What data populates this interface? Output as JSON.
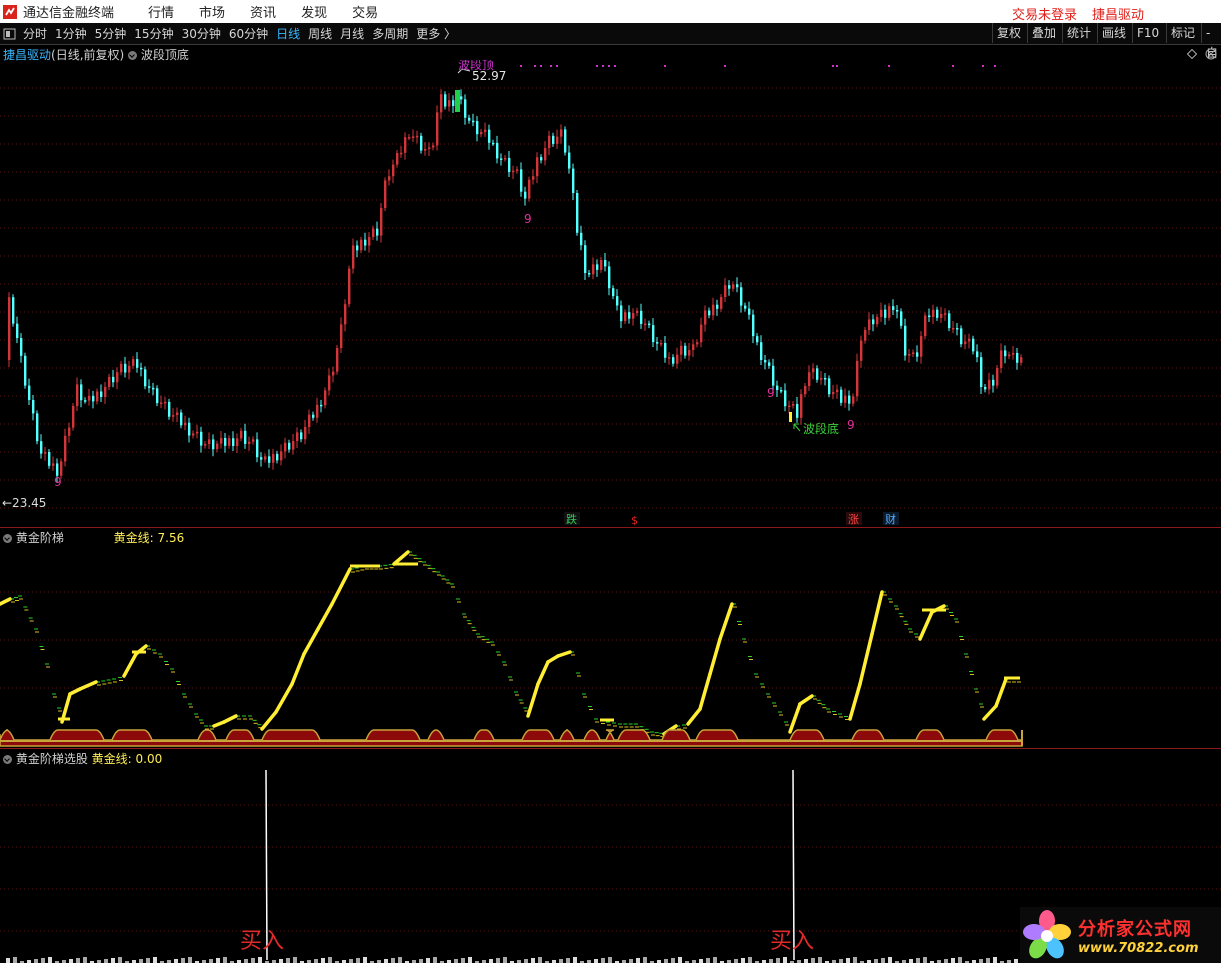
{
  "app": {
    "title": "通达信金融终端",
    "menus": [
      "行情",
      "市场",
      "资讯",
      "发现",
      "交易"
    ],
    "login_status": "交易未登录",
    "stock_name": "捷昌驱动"
  },
  "toolbar": {
    "periods": [
      "分时",
      "1分钟",
      "5分钟",
      "15分钟",
      "30分钟",
      "60分钟",
      "日线",
      "周线",
      "月线",
      "多周期",
      "更多 〉"
    ],
    "active_period": "日线",
    "right_buttons": [
      "复权",
      "叠加",
      "统计",
      "画线",
      "F10",
      "标记",
      "-自"
    ]
  },
  "main_panel": {
    "stock_name": "捷昌驱动",
    "mode": "(日线,前复权)",
    "indicator": "波段顶底",
    "high_label": "52.97",
    "low_label": "←23.45",
    "trough_label": "波段底",
    "peak_label": "波段顶",
    "nine_label": "9",
    "events": [
      {
        "text": "跌",
        "color": "#33cc55"
      },
      {
        "text": "$",
        "color": "#e02020"
      },
      {
        "text": "涨",
        "color": "#ff4444"
      },
      {
        "text": "财",
        "color": "#55aaff"
      }
    ]
  },
  "ladder_panel": {
    "name": "黄金阶梯",
    "line_label": "黄金线:",
    "line_value": "7.56"
  },
  "select_panel": {
    "name": "黄金阶梯选股",
    "line_label": "黄金线:",
    "line_value": "0.00",
    "buy_label": "买入"
  },
  "watermark": {
    "name": "分析家公式网",
    "url": "www.70822.com"
  },
  "colors": {
    "up": "#d2363a",
    "down": "#54ffff",
    "gold": "#ffee33",
    "base_fill": "#8c0a0a",
    "green_dash": "#28d228"
  },
  "icons": {
    "logo": "tdx-logo-icon",
    "collapse": "collapse-circle-icon",
    "watermark": "flower-logo-icon"
  }
}
